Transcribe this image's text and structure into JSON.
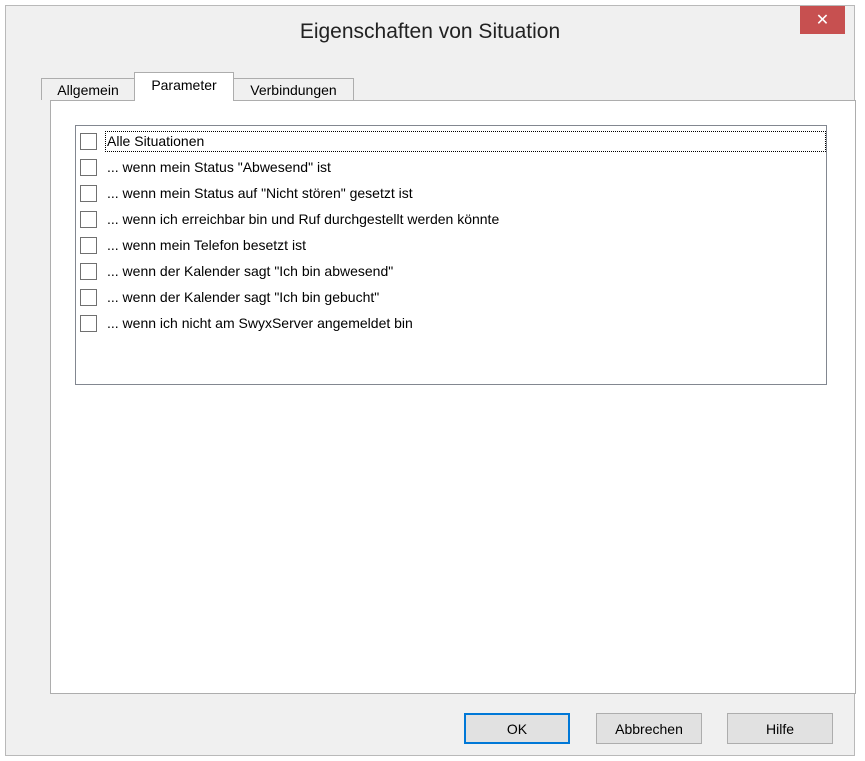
{
  "window": {
    "title": "Eigenschaften von Situation",
    "close_glyph": "✕"
  },
  "tabs": [
    {
      "label": "Allgemein"
    },
    {
      "label": "Parameter"
    },
    {
      "label": "Verbindungen"
    }
  ],
  "active_tab": "Parameter",
  "situations": [
    {
      "label": "Alle Situationen",
      "checked": false
    },
    {
      "label": "... wenn mein Status \"Abwesend\" ist",
      "checked": false
    },
    {
      "label": "... wenn mein Status auf \"Nicht stören\" gesetzt ist",
      "checked": false
    },
    {
      "label": "... wenn ich erreichbar bin und Ruf durchgestellt werden könnte",
      "checked": false
    },
    {
      "label": "... wenn mein Telefon besetzt ist",
      "checked": false
    },
    {
      "label": "... wenn der Kalender sagt \"Ich bin abwesend\"",
      "checked": false
    },
    {
      "label": "... wenn der Kalender sagt \"Ich bin gebucht\"",
      "checked": false
    },
    {
      "label": "... wenn ich nicht am SwyxServer angemeldet bin",
      "checked": false
    }
  ],
  "buttons": {
    "ok": "OK",
    "cancel": "Abbrechen",
    "help": "Hilfe"
  },
  "colors": {
    "close_button": "#c75050",
    "default_button_border": "#0078d7"
  }
}
